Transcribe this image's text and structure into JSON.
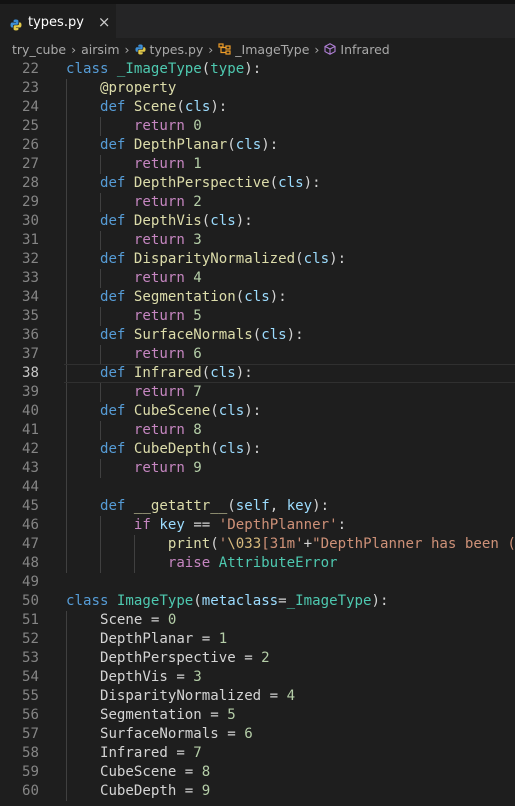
{
  "tab": {
    "filename": "types.py",
    "close_glyph": "×",
    "icon": "python-icon"
  },
  "breadcrumb": [
    "try_cube",
    "airsim",
    "types.py",
    "_ImageType",
    "Infrared"
  ],
  "breadcrumb_sep": "›",
  "current_line": 38,
  "colors": {
    "keyword": "#569cd6",
    "control": "#c586c0",
    "class": "#4ec9b0",
    "function": "#dcdcaa",
    "param": "#9cdcfe",
    "number": "#b5cea8",
    "string": "#ce9178"
  },
  "lines": [
    {
      "n": 22,
      "indent": 0,
      "tokens": [
        [
          "kw",
          "class "
        ],
        [
          "cls",
          "_ImageType"
        ],
        [
          "plain",
          "("
        ],
        [
          "cls",
          "type"
        ],
        [
          "plain",
          "):"
        ]
      ]
    },
    {
      "n": 23,
      "indent": 1,
      "tokens": [
        [
          "dec",
          "@property"
        ]
      ]
    },
    {
      "n": 24,
      "indent": 1,
      "tokens": [
        [
          "kw",
          "def "
        ],
        [
          "fn",
          "Scene"
        ],
        [
          "plain",
          "("
        ],
        [
          "prm",
          "cls"
        ],
        [
          "plain",
          "):"
        ]
      ]
    },
    {
      "n": 25,
      "indent": 2,
      "tokens": [
        [
          "ctl",
          "return "
        ],
        [
          "num",
          "0"
        ]
      ]
    },
    {
      "n": 26,
      "indent": 1,
      "tokens": [
        [
          "kw",
          "def "
        ],
        [
          "fn",
          "DepthPlanar"
        ],
        [
          "plain",
          "("
        ],
        [
          "prm",
          "cls"
        ],
        [
          "plain",
          "):"
        ]
      ]
    },
    {
      "n": 27,
      "indent": 2,
      "tokens": [
        [
          "ctl",
          "return "
        ],
        [
          "num",
          "1"
        ]
      ]
    },
    {
      "n": 28,
      "indent": 1,
      "tokens": [
        [
          "kw",
          "def "
        ],
        [
          "fn",
          "DepthPerspective"
        ],
        [
          "plain",
          "("
        ],
        [
          "prm",
          "cls"
        ],
        [
          "plain",
          "):"
        ]
      ]
    },
    {
      "n": 29,
      "indent": 2,
      "tokens": [
        [
          "ctl",
          "return "
        ],
        [
          "num",
          "2"
        ]
      ]
    },
    {
      "n": 30,
      "indent": 1,
      "tokens": [
        [
          "kw",
          "def "
        ],
        [
          "fn",
          "DepthVis"
        ],
        [
          "plain",
          "("
        ],
        [
          "prm",
          "cls"
        ],
        [
          "plain",
          "):"
        ]
      ]
    },
    {
      "n": 31,
      "indent": 2,
      "tokens": [
        [
          "ctl",
          "return "
        ],
        [
          "num",
          "3"
        ]
      ]
    },
    {
      "n": 32,
      "indent": 1,
      "tokens": [
        [
          "kw",
          "def "
        ],
        [
          "fn",
          "DisparityNormalized"
        ],
        [
          "plain",
          "("
        ],
        [
          "prm",
          "cls"
        ],
        [
          "plain",
          "):"
        ]
      ]
    },
    {
      "n": 33,
      "indent": 2,
      "tokens": [
        [
          "ctl",
          "return "
        ],
        [
          "num",
          "4"
        ]
      ]
    },
    {
      "n": 34,
      "indent": 1,
      "tokens": [
        [
          "kw",
          "def "
        ],
        [
          "fn",
          "Segmentation"
        ],
        [
          "plain",
          "("
        ],
        [
          "prm",
          "cls"
        ],
        [
          "plain",
          "):"
        ]
      ]
    },
    {
      "n": 35,
      "indent": 2,
      "tokens": [
        [
          "ctl",
          "return "
        ],
        [
          "num",
          "5"
        ]
      ]
    },
    {
      "n": 36,
      "indent": 1,
      "tokens": [
        [
          "kw",
          "def "
        ],
        [
          "fn",
          "SurfaceNormals"
        ],
        [
          "plain",
          "("
        ],
        [
          "prm",
          "cls"
        ],
        [
          "plain",
          "):"
        ]
      ]
    },
    {
      "n": 37,
      "indent": 2,
      "tokens": [
        [
          "ctl",
          "return "
        ],
        [
          "num",
          "6"
        ]
      ]
    },
    {
      "n": 38,
      "indent": 1,
      "tokens": [
        [
          "kw",
          "def "
        ],
        [
          "fn",
          "Infrared"
        ],
        [
          "plain",
          "("
        ],
        [
          "prm",
          "cls"
        ],
        [
          "plain",
          "):"
        ]
      ]
    },
    {
      "n": 39,
      "indent": 2,
      "tokens": [
        [
          "ctl",
          "return "
        ],
        [
          "num",
          "7"
        ]
      ]
    },
    {
      "n": 40,
      "indent": 1,
      "tokens": [
        [
          "kw",
          "def "
        ],
        [
          "fn",
          "CubeScene"
        ],
        [
          "plain",
          "("
        ],
        [
          "prm",
          "cls"
        ],
        [
          "plain",
          "):"
        ]
      ]
    },
    {
      "n": 41,
      "indent": 2,
      "tokens": [
        [
          "ctl",
          "return "
        ],
        [
          "num",
          "8"
        ]
      ]
    },
    {
      "n": 42,
      "indent": 1,
      "tokens": [
        [
          "kw",
          "def "
        ],
        [
          "fn",
          "CubeDepth"
        ],
        [
          "plain",
          "("
        ],
        [
          "prm",
          "cls"
        ],
        [
          "plain",
          "):"
        ]
      ]
    },
    {
      "n": 43,
      "indent": 2,
      "tokens": [
        [
          "ctl",
          "return "
        ],
        [
          "num",
          "9"
        ]
      ]
    },
    {
      "n": 44,
      "indent": 1,
      "tokens": []
    },
    {
      "n": 45,
      "indent": 1,
      "tokens": [
        [
          "kw",
          "def "
        ],
        [
          "fn",
          "__getattr__"
        ],
        [
          "plain",
          "("
        ],
        [
          "prm",
          "self"
        ],
        [
          "plain",
          ", "
        ],
        [
          "prm",
          "key"
        ],
        [
          "plain",
          "):"
        ]
      ]
    },
    {
      "n": 46,
      "indent": 2,
      "tokens": [
        [
          "ctl",
          "if "
        ],
        [
          "prm",
          "key"
        ],
        [
          "plain",
          " == "
        ],
        [
          "str",
          "'DepthPlanner'"
        ],
        [
          "plain",
          ":"
        ]
      ]
    },
    {
      "n": 47,
      "indent": 3,
      "tokens": [
        [
          "fn",
          "print"
        ],
        [
          "plain",
          "("
        ],
        [
          "str",
          "'"
        ],
        [
          "esc",
          "\\033"
        ],
        [
          "str",
          "[31m'"
        ],
        [
          "plain",
          "+"
        ],
        [
          "str",
          "\"DepthPlanner has been (d"
        ]
      ]
    },
    {
      "n": 48,
      "indent": 3,
      "tokens": [
        [
          "ctl",
          "raise "
        ],
        [
          "cls",
          "AttributeError"
        ]
      ]
    },
    {
      "n": 49,
      "indent": 0,
      "tokens": []
    },
    {
      "n": 50,
      "indent": 0,
      "tokens": [
        [
          "kw",
          "class "
        ],
        [
          "cls",
          "ImageType"
        ],
        [
          "plain",
          "("
        ],
        [
          "prm",
          "metaclass"
        ],
        [
          "plain",
          "="
        ],
        [
          "cls",
          "_ImageType"
        ],
        [
          "plain",
          "):"
        ]
      ]
    },
    {
      "n": 51,
      "indent": 1,
      "tokens": [
        [
          "plain",
          "Scene = "
        ],
        [
          "num",
          "0"
        ]
      ]
    },
    {
      "n": 52,
      "indent": 1,
      "tokens": [
        [
          "plain",
          "DepthPlanar = "
        ],
        [
          "num",
          "1"
        ]
      ]
    },
    {
      "n": 53,
      "indent": 1,
      "tokens": [
        [
          "plain",
          "DepthPerspective = "
        ],
        [
          "num",
          "2"
        ]
      ]
    },
    {
      "n": 54,
      "indent": 1,
      "tokens": [
        [
          "plain",
          "DepthVis = "
        ],
        [
          "num",
          "3"
        ]
      ]
    },
    {
      "n": 55,
      "indent": 1,
      "tokens": [
        [
          "plain",
          "DisparityNormalized = "
        ],
        [
          "num",
          "4"
        ]
      ]
    },
    {
      "n": 56,
      "indent": 1,
      "tokens": [
        [
          "plain",
          "Segmentation = "
        ],
        [
          "num",
          "5"
        ]
      ]
    },
    {
      "n": 57,
      "indent": 1,
      "tokens": [
        [
          "plain",
          "SurfaceNormals = "
        ],
        [
          "num",
          "6"
        ]
      ]
    },
    {
      "n": 58,
      "indent": 1,
      "tokens": [
        [
          "plain",
          "Infrared = "
        ],
        [
          "num",
          "7"
        ]
      ]
    },
    {
      "n": 59,
      "indent": 1,
      "tokens": [
        [
          "plain",
          "CubeScene = "
        ],
        [
          "num",
          "8"
        ]
      ]
    },
    {
      "n": 60,
      "indent": 1,
      "tokens": [
        [
          "plain",
          "CubeDepth = "
        ],
        [
          "num",
          "9"
        ]
      ]
    }
  ]
}
